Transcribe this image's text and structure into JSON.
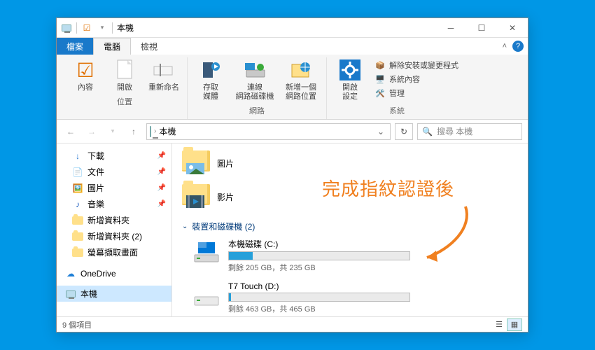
{
  "window": {
    "title": "本機"
  },
  "tabs": {
    "file": "檔案",
    "computer": "電腦",
    "view": "檢視"
  },
  "ribbon": {
    "location": {
      "properties": "內容",
      "open": "開啟",
      "rename": "重新命名",
      "group": "位置"
    },
    "network": {
      "media": "存取\n媒體",
      "netdrive": "連線\n網路磁碟機",
      "netloc": "新增一個\n網路位置",
      "group": "網路"
    },
    "system": {
      "settings": "開啟\n設定",
      "uninstall": "解除安裝或變更程式",
      "sysprops": "系統內容",
      "manage": "管理",
      "group": "系統"
    }
  },
  "nav": {
    "location": "本機",
    "search_placeholder": "搜尋 本機"
  },
  "sidebar": {
    "items": [
      {
        "label": "下載",
        "icon": "download",
        "pinned": true
      },
      {
        "label": "文件",
        "icon": "document",
        "pinned": true
      },
      {
        "label": "圖片",
        "icon": "picture",
        "pinned": true
      },
      {
        "label": "音樂",
        "icon": "music",
        "pinned": true
      },
      {
        "label": "新增資料夾",
        "icon": "folder",
        "pinned": false
      },
      {
        "label": "新增資料夾 (2)",
        "icon": "folder",
        "pinned": false
      },
      {
        "label": "螢幕擷取畫面",
        "icon": "folder",
        "pinned": false
      }
    ],
    "onedrive": "OneDrive",
    "thispc": "本機"
  },
  "content": {
    "folders": [
      {
        "label": "圖片",
        "thumb": "picture"
      },
      {
        "label": "影片",
        "thumb": "video"
      }
    ],
    "drives_header": "裝置和磁碟機 (2)",
    "drives": [
      {
        "name": "本機磁碟 (C:)",
        "free": "剩餘 205 GB",
        "total": "共 235 GB",
        "fill_pct": 13
      },
      {
        "name": "T7 Touch (D:)",
        "free": "剩餘 463 GB",
        "total": "共 465 GB",
        "fill_pct": 1
      }
    ]
  },
  "statusbar": {
    "count": "9 個項目"
  },
  "annotation": {
    "text": "完成指紋認證後"
  }
}
